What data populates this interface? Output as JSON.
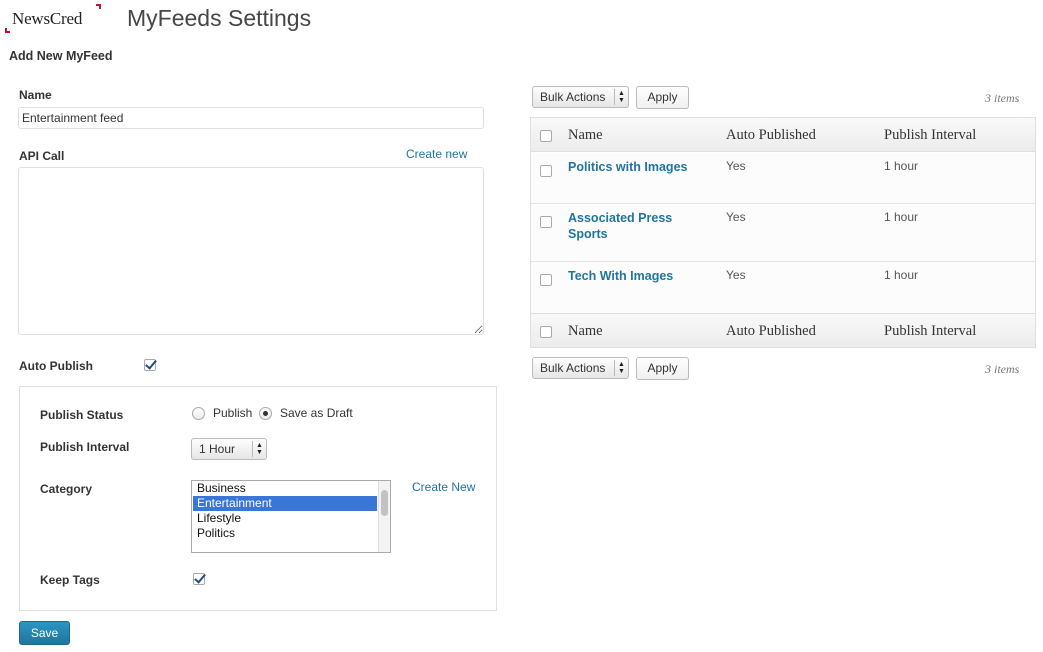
{
  "header": {
    "logo_text": "NewsCred",
    "page_title": "MyFeeds Settings"
  },
  "form": {
    "section_title": "Add New MyFeed",
    "name_label": "Name",
    "name_value": "Entertainment feed",
    "api_label": "API Call",
    "api_create_link": "Create new",
    "api_value": "",
    "auto_publish_label": "Auto Publish",
    "auto_publish_checked": true,
    "publish_status_label": "Publish Status",
    "publish_option": "Publish",
    "draft_option": "Save as Draft",
    "publish_status_selected": "Save as Draft",
    "publish_interval_label": "Publish Interval",
    "publish_interval_value": "1 Hour",
    "category_label": "Category",
    "category_create_link": "Create New",
    "categories": [
      "Business",
      "Entertainment",
      "Lifestyle",
      "Politics"
    ],
    "category_selected": "Entertainment",
    "keep_tags_label": "Keep Tags",
    "keep_tags_checked": true,
    "save_label": "Save"
  },
  "list": {
    "bulk_actions_label": "Bulk Actions",
    "apply_label": "Apply",
    "items_count": "3 items",
    "columns": [
      "Name",
      "Auto Published",
      "Publish Interval"
    ],
    "rows": [
      {
        "name": "Politics with Images",
        "auto_published": "Yes",
        "interval": "1 hour"
      },
      {
        "name": "Associated Press Sports",
        "auto_published": "Yes",
        "interval": "1 hour"
      },
      {
        "name": "Tech With Images",
        "auto_published": "Yes",
        "interval": "1 hour"
      }
    ]
  },
  "colors": {
    "link": "#21759b",
    "brand": "#c8102e",
    "selected": "#3a75d8"
  }
}
